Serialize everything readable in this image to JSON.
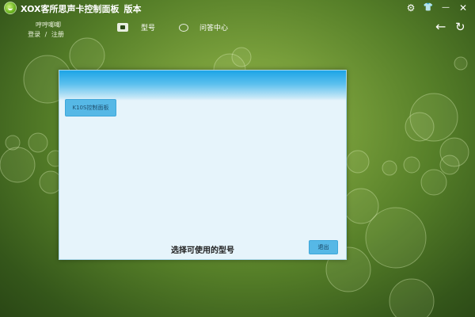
{
  "window": {
    "title": "XOX客所思声卡控制面板",
    "version_label": "版本",
    "controls": [
      {
        "name": "settings-icon",
        "glyph": "⚙"
      },
      {
        "name": "skin-icon",
        "glyph": "👕"
      },
      {
        "name": "minimize-icon",
        "glyph": "—"
      },
      {
        "name": "close-icon",
        "glyph": "✕"
      }
    ]
  },
  "user": {
    "name": "哼哼唧唧",
    "login": "登录",
    "separator": "/",
    "register": "注册"
  },
  "nav": {
    "models": "型号",
    "qa": "问答中心",
    "back_glyph": "←",
    "refresh_glyph": "↻"
  },
  "dialog": {
    "model_option": "K10S控制面板",
    "caption": "选择可使用的型号",
    "exit_label": "退出"
  },
  "colors": {
    "accent": "#56b8e6",
    "header_blue": "#1ca4e6",
    "dialog_bg": "#e6f4fb"
  }
}
